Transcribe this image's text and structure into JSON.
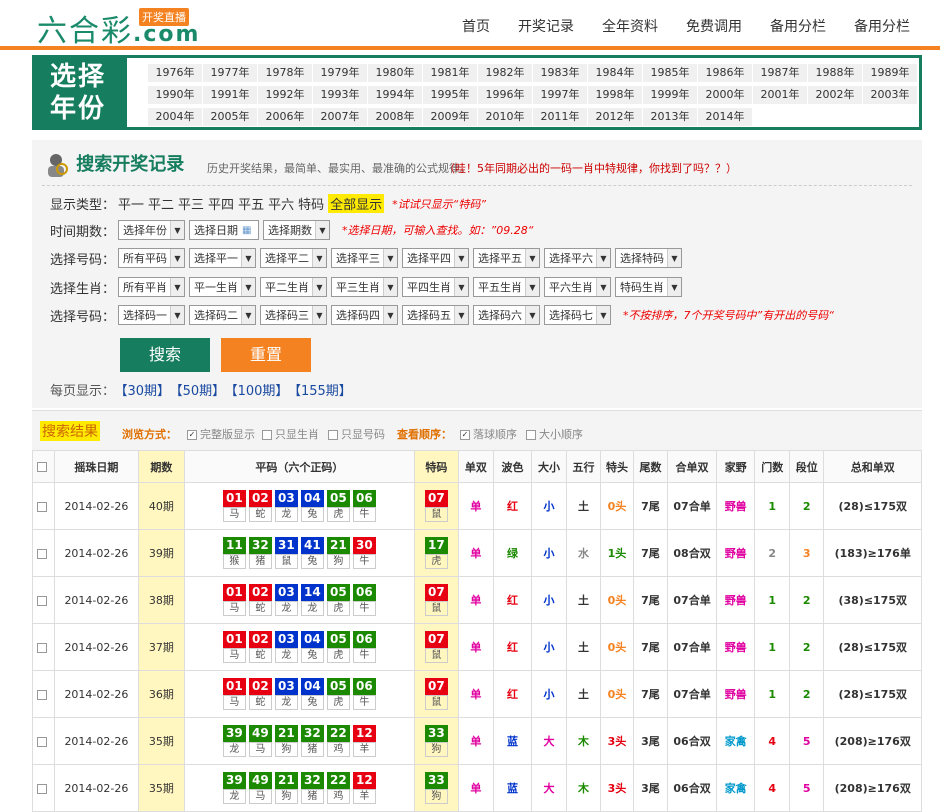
{
  "site": {
    "logo": "六合彩",
    "logo_com": ".com",
    "logo_tag": "开奖直播"
  },
  "nav": [
    "首页",
    "开奖记录",
    "全年资料",
    "免费调用",
    "备用分栏",
    "备用分栏"
  ],
  "years_title": [
    "选择",
    "年份"
  ],
  "years": [
    "1976年",
    "1977年",
    "1978年",
    "1979年",
    "1980年",
    "1981年",
    "1982年",
    "1983年",
    "1984年",
    "1985年",
    "1986年",
    "1987年",
    "1988年",
    "1989年",
    "1990年",
    "1991年",
    "1992年",
    "1993年",
    "1994年",
    "1995年",
    "1996年",
    "1997年",
    "1998年",
    "1999年",
    "2000年",
    "2001年",
    "2002年",
    "2003年",
    "2004年",
    "2005年",
    "2006年",
    "2007年",
    "2008年",
    "2009年",
    "2010年",
    "2011年",
    "2012年",
    "2013年",
    "2014年"
  ],
  "search": {
    "title": "搜索开奖记录",
    "desc": "历史开奖结果，最简单、最实用、最准确的公式规律。",
    "desc2": "（哇！5年同期必出的一码一肖中特规律，你找到了吗？？）",
    "type_label": "显示类型：",
    "types": [
      "平一",
      "平二",
      "平三",
      "平四",
      "平五",
      "平六",
      "特码"
    ],
    "type_all": "全部显示",
    "type_hint": "*试试只显示“特码”",
    "time_label": "时间期数：",
    "time_sel": [
      "选择年份",
      "选择日期",
      "选择期数"
    ],
    "time_hint": "*选择日期，可输入查找。如：”09.28“",
    "num_label": "选择号码：",
    "num_sel": [
      "所有平码",
      "选择平一",
      "选择平二",
      "选择平三",
      "选择平四",
      "选择平五",
      "选择平六",
      "选择特码"
    ],
    "zodiac_label": "选择生肖：",
    "zodiac_sel": [
      "所有平肖",
      "平一生肖",
      "平二生肖",
      "平三生肖",
      "平四生肖",
      "平五生肖",
      "平六生肖",
      "特码生肖"
    ],
    "code_label": "选择号码：",
    "code_sel": [
      "选择码一",
      "选择码二",
      "选择码三",
      "选择码四",
      "选择码五",
      "选择码六",
      "选择码七"
    ],
    "code_hint": "*不按排序，7个开奖号码中”有开出的号码“",
    "btn_search": "搜索",
    "btn_reset": "重置",
    "per_page": "每页显示：",
    "per_opts": [
      "【30期】",
      "【50期】",
      "【100期】",
      "【155期】"
    ]
  },
  "results": {
    "title": "搜索结果",
    "view_label": "浏览方式：",
    "view_opts": [
      "完整版显示",
      "只显生肖",
      "只显号码"
    ],
    "order_label": "查看顺序：",
    "order_opts": [
      "落球顺序",
      "大小顺序"
    ]
  },
  "table": {
    "headers": [
      "摇珠日期",
      "期数",
      "平码（六个正码）",
      "特码",
      "单双",
      "波色",
      "大小",
      "五行",
      "特头",
      "尾数",
      "合单双",
      "家野",
      "门数",
      "段位",
      "总和单双"
    ],
    "rows": [
      {
        "date": "2014-02-26",
        "qi": "40期",
        "balls": [
          [
            "01",
            "马",
            "red"
          ],
          [
            "02",
            "蛇",
            "red"
          ],
          [
            "03",
            "龙",
            "blue"
          ],
          [
            "04",
            "兔",
            "blue"
          ],
          [
            "05",
            "虎",
            "green"
          ],
          [
            "06",
            "牛",
            "green"
          ]
        ],
        "te": [
          "07",
          "鼠",
          "red"
        ],
        "ds": "单",
        "bs": "红",
        "dx": "小",
        "wx": "土",
        "tt": "0头",
        "ws": "7尾",
        "hds": "07合单",
        "jy": "野兽",
        "ms": "1",
        "dw": "2",
        "zh": "(28)≤175双"
      },
      {
        "date": "2014-02-26",
        "qi": "39期",
        "balls": [
          [
            "11",
            "猴",
            "green"
          ],
          [
            "32",
            "猪",
            "green"
          ],
          [
            "31",
            "鼠",
            "blue"
          ],
          [
            "41",
            "兔",
            "blue"
          ],
          [
            "21",
            "狗",
            "green"
          ],
          [
            "30",
            "牛",
            "red"
          ]
        ],
        "te": [
          "17",
          "虎",
          "green"
        ],
        "ds": "单",
        "bs": "绿",
        "dx": "小",
        "wx": "水",
        "tt": "1头",
        "ws": "7尾",
        "hds": "08合双",
        "jy": "野兽",
        "ms": "2",
        "dw": "3",
        "zh": "(183)≥176单"
      },
      {
        "date": "2014-02-26",
        "qi": "38期",
        "balls": [
          [
            "01",
            "马",
            "red"
          ],
          [
            "02",
            "蛇",
            "red"
          ],
          [
            "03",
            "龙",
            "blue"
          ],
          [
            "14",
            "龙",
            "blue"
          ],
          [
            "05",
            "虎",
            "green"
          ],
          [
            "06",
            "牛",
            "green"
          ]
        ],
        "te": [
          "07",
          "鼠",
          "red"
        ],
        "ds": "单",
        "bs": "红",
        "dx": "小",
        "wx": "土",
        "tt": "0头",
        "ws": "7尾",
        "hds": "07合单",
        "jy": "野兽",
        "ms": "1",
        "dw": "2",
        "zh": "(38)≤175双"
      },
      {
        "date": "2014-02-26",
        "qi": "37期",
        "balls": [
          [
            "01",
            "马",
            "red"
          ],
          [
            "02",
            "蛇",
            "red"
          ],
          [
            "03",
            "龙",
            "blue"
          ],
          [
            "04",
            "兔",
            "blue"
          ],
          [
            "05",
            "虎",
            "green"
          ],
          [
            "06",
            "牛",
            "green"
          ]
        ],
        "te": [
          "07",
          "鼠",
          "red"
        ],
        "ds": "单",
        "bs": "红",
        "dx": "小",
        "wx": "土",
        "tt": "0头",
        "ws": "7尾",
        "hds": "07合单",
        "jy": "野兽",
        "ms": "1",
        "dw": "2",
        "zh": "(28)≤175双"
      },
      {
        "date": "2014-02-26",
        "qi": "36期",
        "balls": [
          [
            "01",
            "马",
            "red"
          ],
          [
            "02",
            "蛇",
            "red"
          ],
          [
            "03",
            "龙",
            "blue"
          ],
          [
            "04",
            "兔",
            "blue"
          ],
          [
            "05",
            "虎",
            "green"
          ],
          [
            "06",
            "牛",
            "green"
          ]
        ],
        "te": [
          "07",
          "鼠",
          "red"
        ],
        "ds": "单",
        "bs": "红",
        "dx": "小",
        "wx": "土",
        "tt": "0头",
        "ws": "7尾",
        "hds": "07合单",
        "jy": "野兽",
        "ms": "1",
        "dw": "2",
        "zh": "(28)≤175双"
      },
      {
        "date": "2014-02-26",
        "qi": "35期",
        "balls": [
          [
            "39",
            "龙",
            "green"
          ],
          [
            "49",
            "马",
            "green"
          ],
          [
            "21",
            "狗",
            "green"
          ],
          [
            "32",
            "猪",
            "green"
          ],
          [
            "22",
            "鸡",
            "green"
          ],
          [
            "12",
            "羊",
            "red"
          ]
        ],
        "te": [
          "33",
          "狗",
          "green"
        ],
        "ds": "单",
        "bs": "蓝",
        "dx": "大",
        "wx": "木",
        "tt": "3头",
        "ws": "3尾",
        "hds": "06合双",
        "jy": "家禽",
        "ms": "4",
        "dw": "5",
        "zh": "(208)≥176双"
      },
      {
        "date": "2014-02-26",
        "qi": "35期",
        "balls": [
          [
            "39",
            "龙",
            "green"
          ],
          [
            "49",
            "马",
            "green"
          ],
          [
            "21",
            "狗",
            "green"
          ],
          [
            "32",
            "猪",
            "green"
          ],
          [
            "22",
            "鸡",
            "green"
          ],
          [
            "12",
            "羊",
            "red"
          ]
        ],
        "te": [
          "33",
          "狗",
          "green"
        ],
        "ds": "单",
        "bs": "蓝",
        "dx": "大",
        "wx": "木",
        "tt": "3头",
        "ws": "3尾",
        "hds": "06合双",
        "jy": "家禽",
        "ms": "4",
        "dw": "5",
        "zh": "(208)≥176双"
      }
    ]
  },
  "colors": {
    "brand": "#167d5f",
    "orange": "#f58220"
  }
}
